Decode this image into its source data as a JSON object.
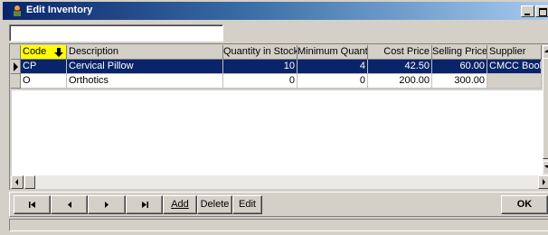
{
  "window": {
    "title": "Edit Inventory"
  },
  "search": {
    "value": "",
    "placeholder": ""
  },
  "grid": {
    "columns": [
      {
        "key": "code",
        "label": "Code",
        "sorted": "descending"
      },
      {
        "key": "description",
        "label": "Description"
      },
      {
        "key": "qty",
        "label": "Quantity in Stock"
      },
      {
        "key": "min",
        "label": "Minimum Quantity"
      },
      {
        "key": "cost",
        "label": "Cost Price"
      },
      {
        "key": "sell",
        "label": "Selling Price"
      },
      {
        "key": "supplier",
        "label": "Supplier"
      }
    ],
    "rows": [
      {
        "code": "CP",
        "description": "Cervical Pillow",
        "qty": "10",
        "min": "4",
        "cost": "42.50",
        "sell": "60.00",
        "supplier": "CMCC Books",
        "selected": true
      },
      {
        "code": "O",
        "description": "Orthotics",
        "qty": "0",
        "min": "0",
        "cost": "200.00",
        "sell": "300.00",
        "supplier": "",
        "selected": false
      }
    ]
  },
  "toolbar": {
    "first_icon": "first-record-icon",
    "prev_icon": "previous-record-icon",
    "next_icon": "next-record-icon",
    "last_icon": "last-record-icon",
    "add_label": "Add",
    "delete_label": "Delete",
    "edit_label": "Edit",
    "ok_label": "OK"
  },
  "colors": {
    "title_start": "#0a246a",
    "title_end": "#a6caf0",
    "selection": "#0a246a",
    "sorted_header": "#ffff00",
    "face": "#d4d0c8"
  }
}
